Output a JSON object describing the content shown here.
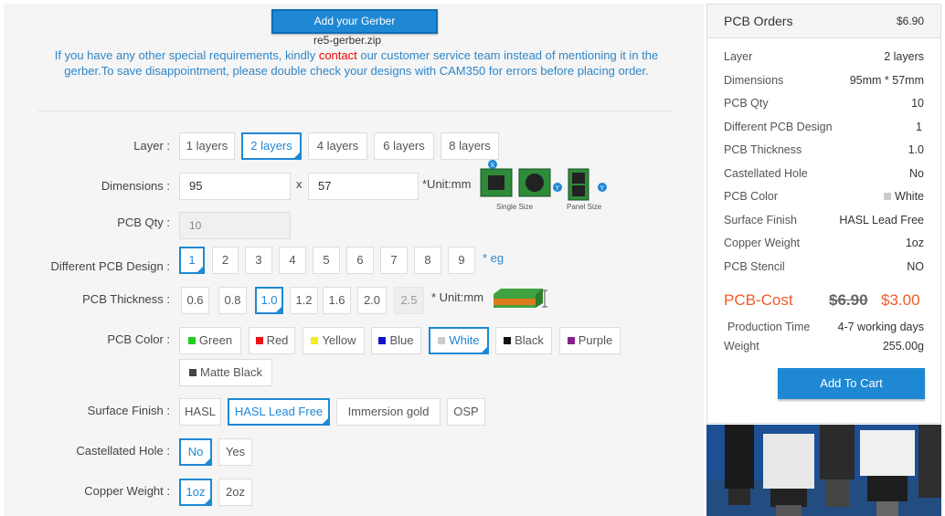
{
  "upload": {
    "button_label": "Add your Gerber",
    "filename": "re5-gerber.zip"
  },
  "notice": {
    "part1": "If you have any other special requirements, kindly ",
    "link": "contact",
    "part2": " our customer service team instead of mentioning it in the gerber.To save disappointment, please double check your designs with CAM350 for errors before placing order."
  },
  "form": {
    "layer": {
      "label": "Layer :",
      "options": [
        "1 layers",
        "2 layers",
        "4 layers",
        "6 layers",
        "8 layers"
      ],
      "selected": "2 layers"
    },
    "dimensions": {
      "label": "Dimensions :",
      "x": "95",
      "sep": "x",
      "y": "57",
      "unit": "*Unit:mm",
      "single_caption": "Single Size",
      "panel_caption": "Panel Size"
    },
    "qty": {
      "label": "PCB Qty :",
      "value": "10"
    },
    "design": {
      "label": "Different PCB Design :",
      "options": [
        "1",
        "2",
        "3",
        "4",
        "5",
        "6",
        "7",
        "8",
        "9"
      ],
      "selected": "1",
      "eg": "* eg"
    },
    "thickness": {
      "label": "PCB Thickness :",
      "options": [
        "0.6",
        "0.8",
        "1.0",
        "1.2",
        "1.6",
        "2.0",
        "2.5"
      ],
      "selected": "1.0",
      "disabled": "2.5",
      "unit": "* Unit:mm"
    },
    "color": {
      "label": "PCB Color :",
      "options": [
        {
          "name": "Green",
          "swatch": "#22cc22"
        },
        {
          "name": "Red",
          "swatch": "#ee1111"
        },
        {
          "name": "Yellow",
          "swatch": "#eeee22"
        },
        {
          "name": "Blue",
          "swatch": "#1111cc"
        },
        {
          "name": "White",
          "swatch": "#cccccc"
        },
        {
          "name": "Black",
          "swatch": "#111111"
        },
        {
          "name": "Purple",
          "swatch": "#882288"
        },
        {
          "name": "Matte Black",
          "swatch": "#444444"
        }
      ],
      "selected": "White"
    },
    "finish": {
      "label": "Surface Finish :",
      "options": [
        "HASL",
        "HASL Lead Free",
        "Immersion gold",
        "OSP"
      ],
      "selected": "HASL Lead Free"
    },
    "castellated": {
      "label": "Castellated Hole :",
      "options": [
        "No",
        "Yes"
      ],
      "selected": "No"
    },
    "copper": {
      "label": "Copper Weight :",
      "options": [
        "1oz",
        "2oz"
      ],
      "selected": "1oz"
    }
  },
  "order": {
    "title": "PCB Orders",
    "price": "$6.90",
    "rows": [
      {
        "k": "Layer",
        "v": "2 layers"
      },
      {
        "k": "Dimensions",
        "v": "95mm * 57mm"
      },
      {
        "k": "PCB Qty",
        "v": "10"
      },
      {
        "k": "Different PCB Design",
        "v": "1"
      },
      {
        "k": "PCB Thickness",
        "v": "1.0"
      },
      {
        "k": "Castellated Hole",
        "v": "No"
      },
      {
        "k": "PCB Color",
        "v": "White"
      },
      {
        "k": "Surface Finish",
        "v": "HASL Lead Free"
      },
      {
        "k": "Copper Weight",
        "v": "1oz"
      },
      {
        "k": "PCB Stencil",
        "v": "NO"
      }
    ],
    "cost_label": "PCB-Cost",
    "old_price": "$6.90",
    "new_price": "$3.00",
    "production_label": "Production Time",
    "production_value": "4-7 working days",
    "weight_label": "Weight",
    "weight_value": "255.00g",
    "cart_label": "Add To Cart"
  },
  "colors": {
    "accent": "#1e88d4",
    "cost": "#f05a28",
    "link": "#e00000"
  }
}
